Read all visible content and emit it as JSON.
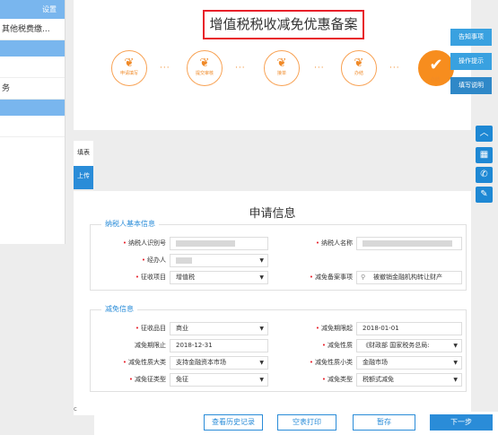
{
  "sidebar": {
    "settings": "设置",
    "item1": "其他税费缴...",
    "item2": "务"
  },
  "header": {
    "title": "增值税税收减免优惠备案"
  },
  "steps": [
    "申请填写",
    "提交审核",
    "接单",
    "办结"
  ],
  "step_done": "办结",
  "side_buttons": [
    "告知事项",
    "操作提示",
    "填写说明"
  ],
  "tabs": {
    "fill": "填表",
    "upload": "上传"
  },
  "form": {
    "title": "申请信息",
    "section1": {
      "title": "纳税人基本信息",
      "taxpayer_id_label": "纳税人识别号",
      "taxpayer_name_label": "纳税人名称",
      "handler_label": "经办人",
      "levy_item_label": "征收项目",
      "levy_item_value": "增值税",
      "matter_label": "减免备案事项",
      "matter_value": "被撤销金融机构转让财产"
    },
    "section2": {
      "title": "减免信息",
      "levy_type_label": "征收品目",
      "levy_type_value": "商业",
      "start_label": "减免期限起",
      "start_value": "2018-01-01",
      "end_label": "减免期限止",
      "end_value": "2018-12-31",
      "nature_label": "减免性质",
      "nature_value": "《财政部 国家税务总局:",
      "big_label": "减免性质大类",
      "big_value": "支持金融资本市场",
      "small_label": "减免性质小类",
      "small_value": "金融市场",
      "cert_label": "减免征类型",
      "cert_value": "免征",
      "type_label": "减免类型",
      "type_value": "税额式减免"
    }
  },
  "bottom": {
    "c_mark": "c",
    "history": "查看历史记录",
    "print": "空表打印",
    "save": "暂存",
    "next": "下一步"
  }
}
